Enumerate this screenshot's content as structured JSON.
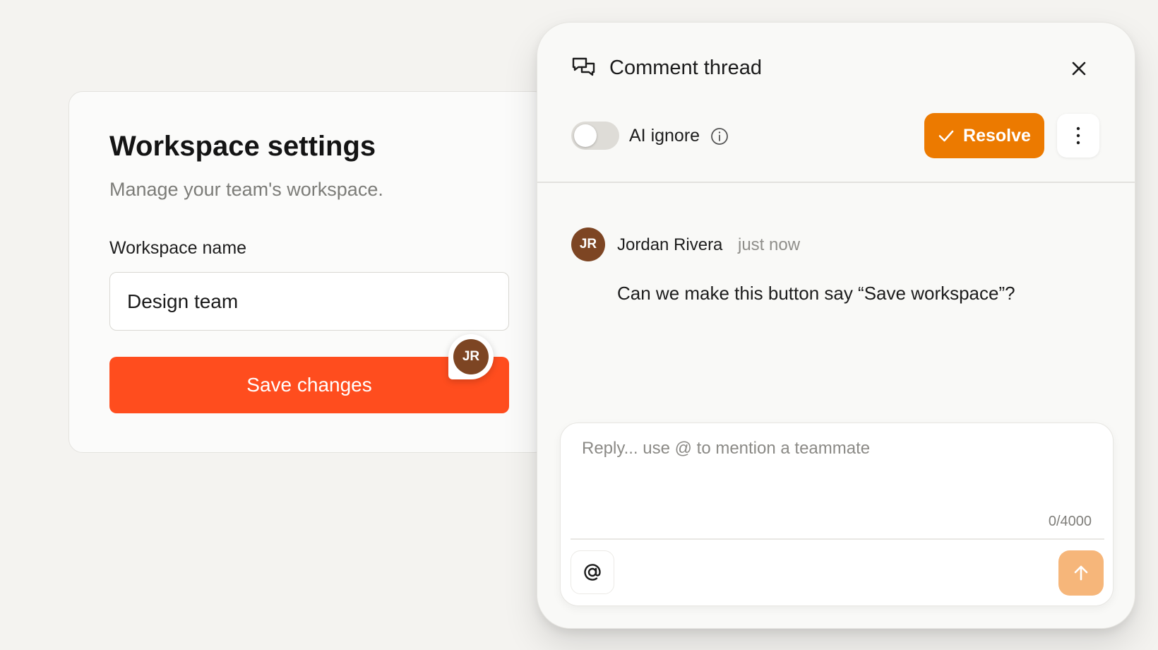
{
  "settings": {
    "title": "Workspace settings",
    "subtitle": "Manage your team's workspace.",
    "name_label": "Workspace name",
    "name_value": "Design team",
    "save_label": "Save changes",
    "pin_initials": "JR"
  },
  "thread": {
    "title": "Comment thread",
    "ai_ignore_label": "AI ignore",
    "ai_ignore_on": false,
    "resolve_label": "Resolve",
    "comment": {
      "initials": "JR",
      "author": "Jordan Rivera",
      "time": "just now",
      "body": "Can we make this button say “Save workspace”?"
    },
    "reply": {
      "placeholder": "Reply... use @ to mention a teammate",
      "char_count": "0/4000"
    }
  },
  "icons": {
    "thread": "chat-bubbles-icon",
    "close": "close-icon",
    "info": "info-icon",
    "resolve": "check-icon",
    "more": "more-vertical-icon",
    "mention": "at-sign-icon",
    "send": "arrow-up-icon"
  },
  "colors": {
    "save_button": "#ff4d1e",
    "resolve_button": "#ec7a00",
    "send_button": "#f6b67a",
    "avatar": "#7d4523"
  }
}
